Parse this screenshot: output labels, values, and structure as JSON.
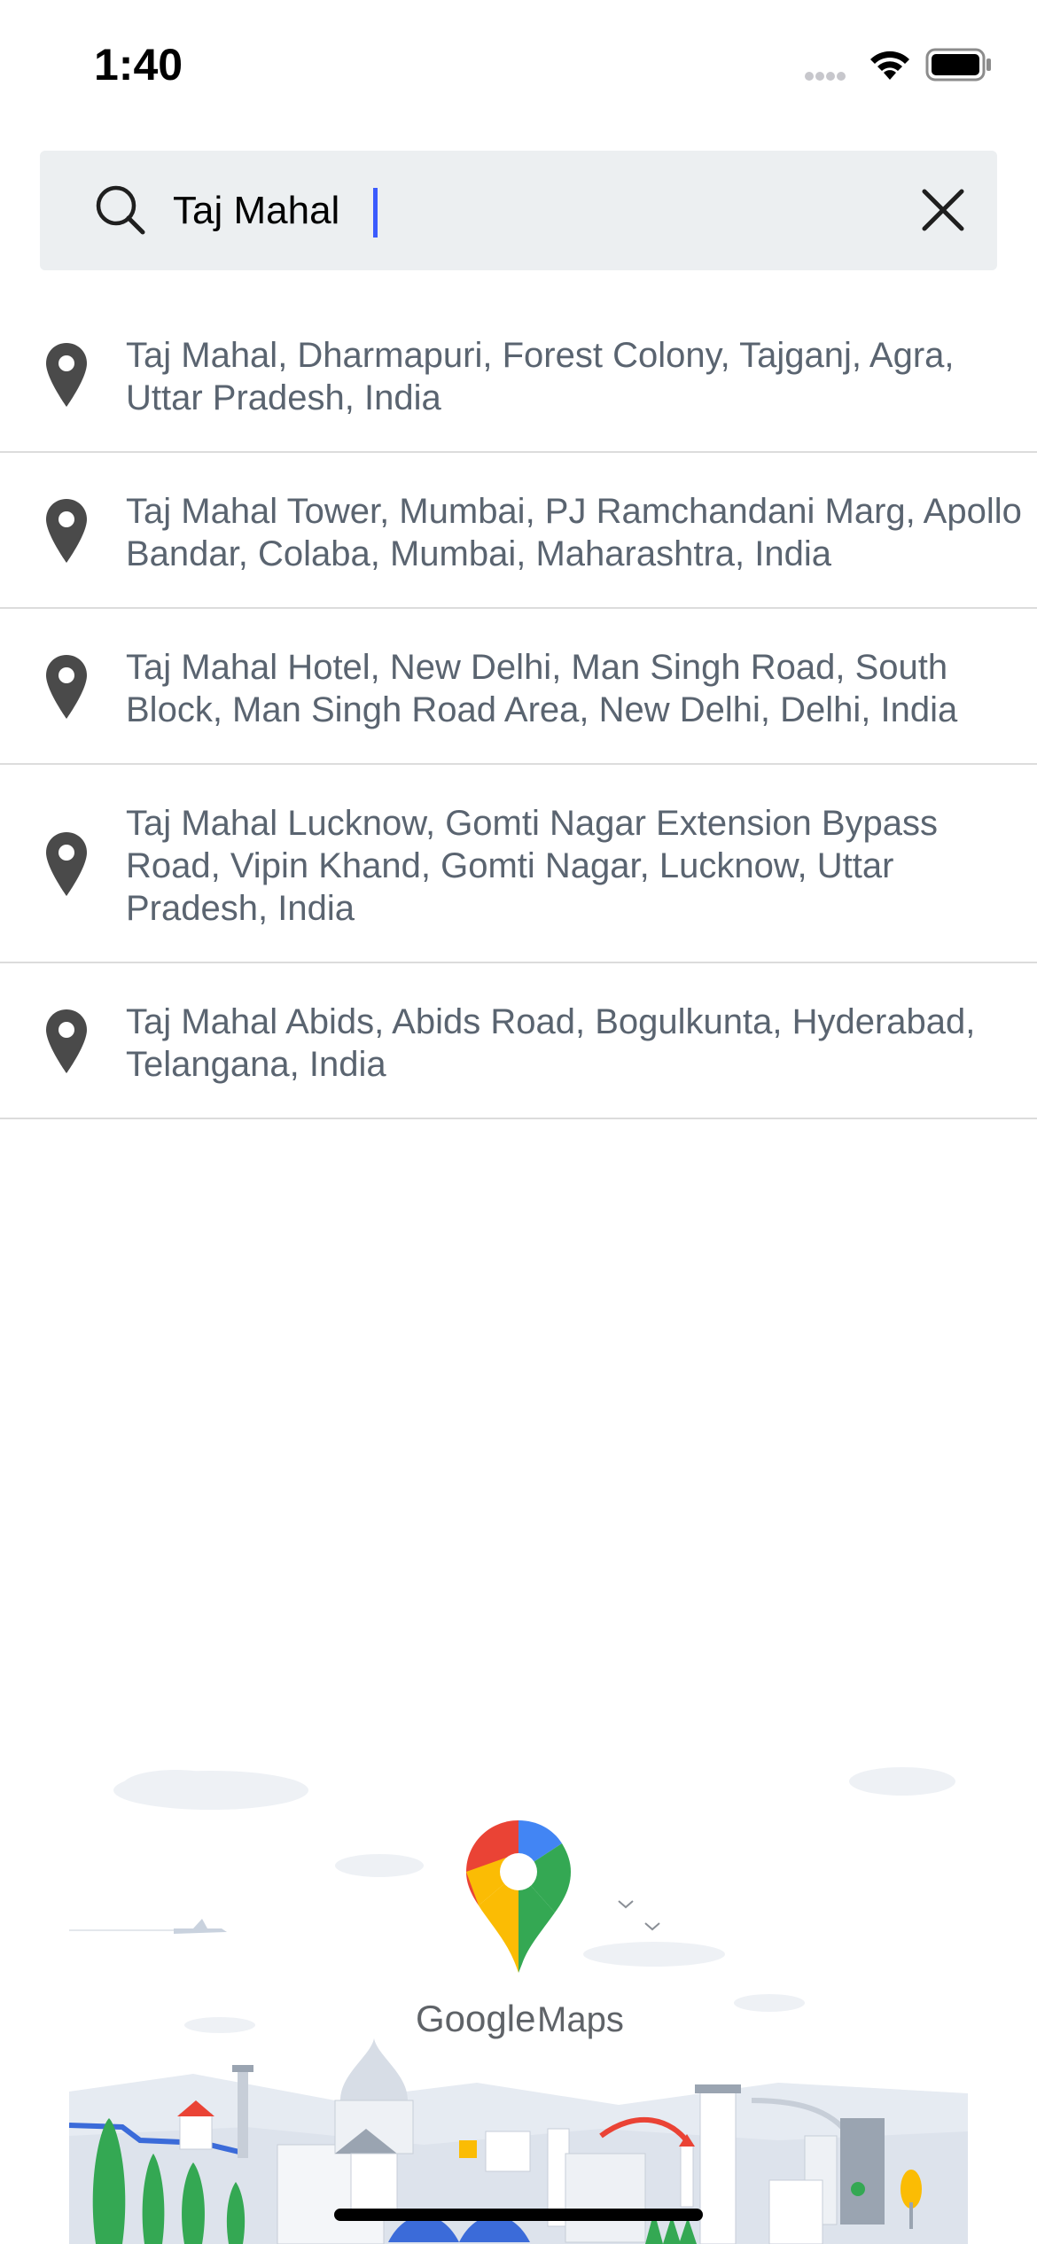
{
  "status_bar": {
    "time": "1:40"
  },
  "search": {
    "value": "Taj Mahal",
    "icon": "search-icon",
    "clear_icon": "close-icon"
  },
  "results": [
    {
      "text": "Taj Mahal, Dharmapuri, Forest Colony, Tajganj, Agra, Uttar Pradesh, India",
      "icon": "location-pin-icon"
    },
    {
      "text": "Taj Mahal Tower, Mumbai, PJ Ramchandani Marg, Apollo Bandar, Colaba, Mumbai, Maharashtra, India",
      "icon": "location-pin-icon"
    },
    {
      "text": "Taj Mahal Hotel, New Delhi, Man Singh Road, South Block, Man Singh Road Area, New Delhi, Delhi, India",
      "icon": "location-pin-icon"
    },
    {
      "text": "Taj Mahal Lucknow, Gomti Nagar Extension Bypass Road, Vipin Khand, Gomti Nagar, Lucknow, Uttar Pradesh, India",
      "icon": "location-pin-icon"
    },
    {
      "text": "Taj Mahal Abids, Abids Road, Bogulkunta, Hyderabad, Telangana, India",
      "icon": "location-pin-icon"
    }
  ],
  "branding": {
    "word_google": "Google",
    "word_maps": "Maps"
  },
  "colors": {
    "cursor": "#3b5bfd",
    "result_text": "#5a6470",
    "search_bg": "#eceff1"
  }
}
